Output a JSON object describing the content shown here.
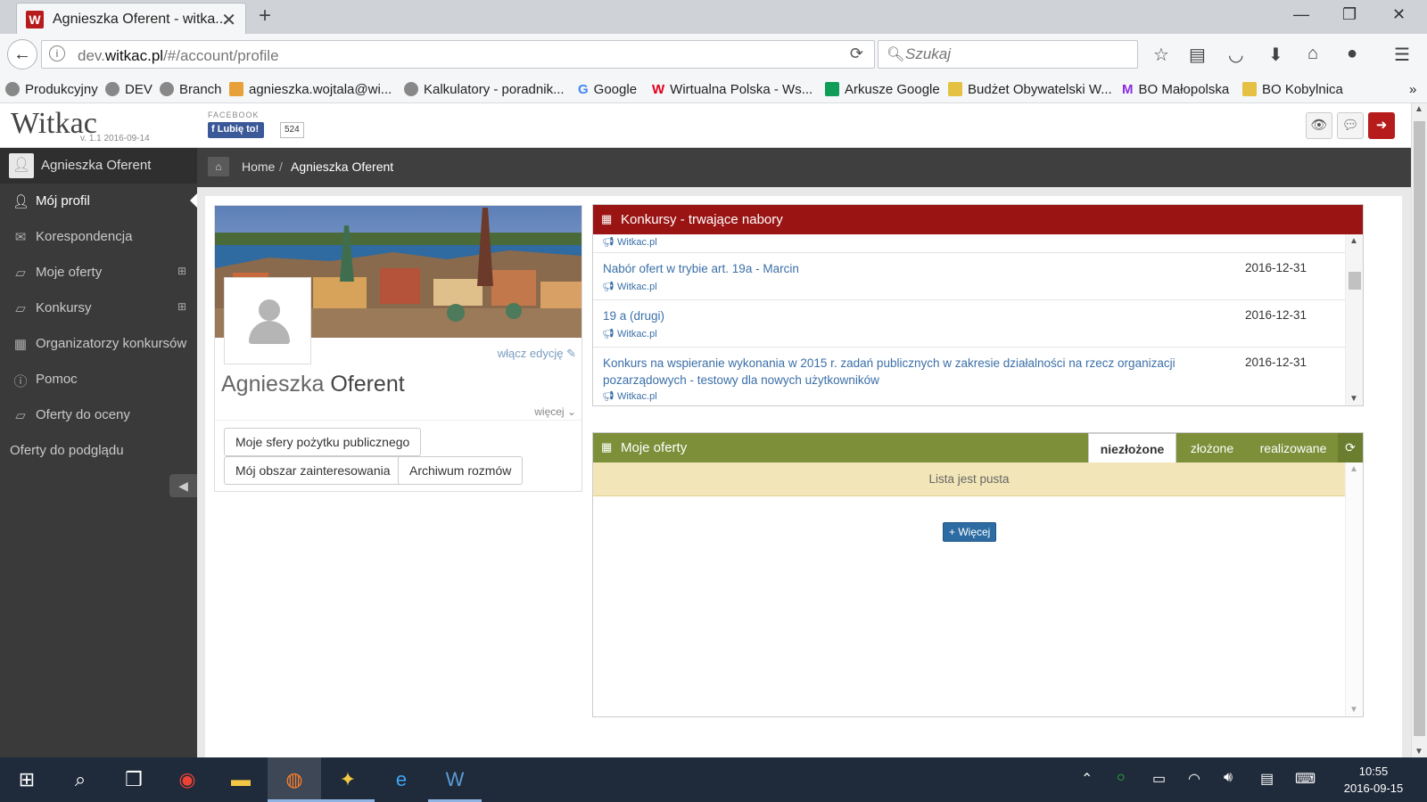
{
  "browser": {
    "tab_title": "Agnieszka Oferent - witka...",
    "tab_favicon": "W",
    "url_prefix": "dev.",
    "url_domain": "witkac.pl",
    "url_path": "/#/account/profile",
    "search_placeholder": "Szukaj",
    "bookmarks": [
      "Produkcyjny",
      "DEV",
      "Branch",
      "agnieszka.wojtala@wi...",
      "Kalkulatory - poradnik...",
      "Google",
      "Wirtualna Polska - Ws...",
      "Arkusze Google",
      "Budżet Obywatelski W...",
      "BO Małopolska",
      "BO Kobylnica"
    ]
  },
  "header": {
    "logo": "Witkac",
    "version": "v. 1.1 2016-09-14",
    "facebook_label": "FACEBOOK",
    "like_label": "Lubię to!",
    "like_count": "524"
  },
  "sidebar": {
    "user": "Agnieszka Oferent",
    "items": [
      {
        "label": "Mój profil",
        "icon": "user-icon"
      },
      {
        "label": "Korespondencja",
        "icon": "envelope-icon"
      },
      {
        "label": "Moje oferty",
        "icon": "book-icon",
        "expand": "⊞"
      },
      {
        "label": "Konkursy",
        "icon": "book-icon",
        "expand": "⊞"
      },
      {
        "label": "Organizatorzy konkursów",
        "icon": "building-icon"
      },
      {
        "label": "Pomoc",
        "icon": "info-icon"
      },
      {
        "label": "Oferty do oceny",
        "icon": "book-icon"
      },
      {
        "label": "Oferty do podglądu"
      }
    ]
  },
  "breadcrumb": {
    "home": "Home",
    "separator": "/",
    "current": "Agnieszka Oferent"
  },
  "profile": {
    "edit_link": "włącz edycję",
    "first_name": "Agnieszka",
    "last_name": "Oferent",
    "more": "więcej",
    "buttons": [
      "Moje sfery pożytku publicznego",
      "Mój obszar zainteresowania",
      "Archiwum rozmów"
    ]
  },
  "konkursy": {
    "title": "Konkursy - trwające nabory",
    "header_color": "#9b1414",
    "rows": [
      {
        "title": "",
        "date": "",
        "source": "Witkac.pl"
      },
      {
        "title": "Nabór ofert w trybie art. 19a - Marcin",
        "date": "2016-12-31",
        "source": "Witkac.pl"
      },
      {
        "title": "19 a (drugi)",
        "date": "2016-12-31",
        "source": "Witkac.pl"
      },
      {
        "title": "Konkurs na wspieranie wykonania w 2015 r. zadań publicznych w zakresie działalności na rzecz organizacji pozarządowych - testowy dla nowych użytkowników",
        "date": "2016-12-31",
        "source": "Witkac.pl"
      }
    ]
  },
  "oferty": {
    "title": "Moje oferty",
    "header_color": "#7e8f3a",
    "tabs": [
      "niezłożone",
      "złożone",
      "realizowane"
    ],
    "active_tab": "niezłożone",
    "empty_text": "Lista jest pusta",
    "more_button": "+ Więcej"
  },
  "taskbar": {
    "time": "10:55",
    "date": "2016-09-15"
  }
}
